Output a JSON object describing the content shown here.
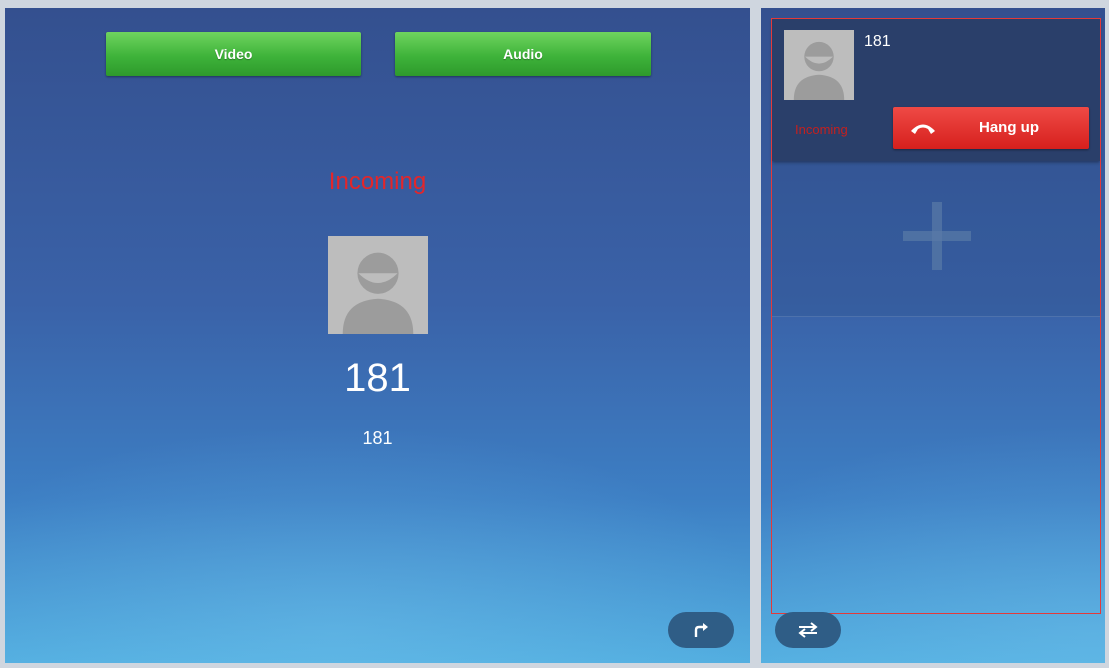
{
  "call": {
    "video_label": "Video",
    "audio_label": "Audio",
    "status": "Incoming",
    "name": "181",
    "number": "181"
  },
  "sidebar": {
    "card": {
      "name": "181",
      "status": "Incoming",
      "hangup_label": "Hang up"
    }
  },
  "icons": {
    "transfer": "transfer-icon",
    "swap": "swap-icon",
    "add": "plus-icon",
    "hangup": "phone-hangup-icon",
    "avatar": "avatar-icon"
  },
  "colors": {
    "accept": "#3eb33a",
    "hangup": "#d6201d",
    "status": "#e3262a"
  }
}
